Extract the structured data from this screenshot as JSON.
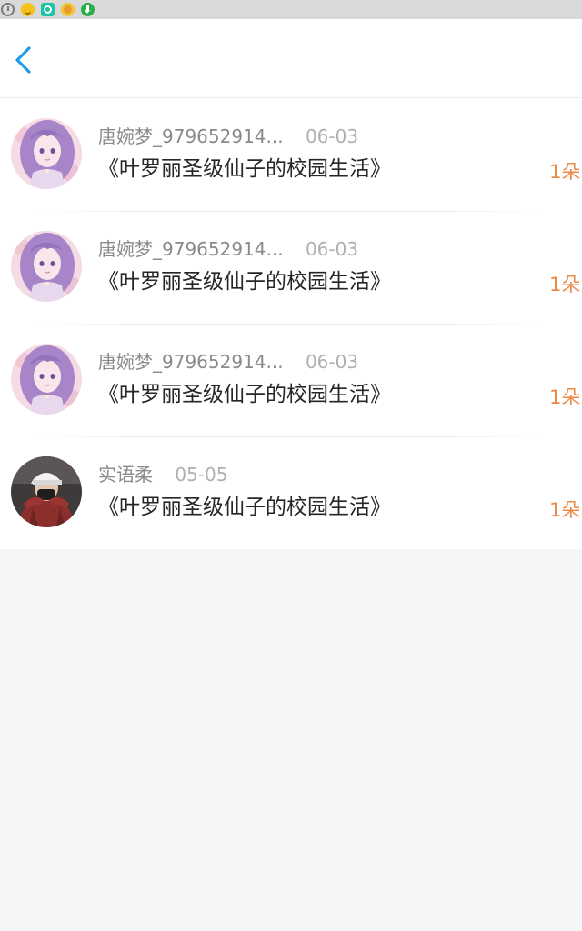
{
  "status_bar": {
    "icons": [
      "alarm-icon",
      "emoji-icon",
      "app-icon",
      "app-icon",
      "download-icon"
    ]
  },
  "nav": {
    "back_icon": "chevron-left-icon"
  },
  "colors": {
    "accent_blue": "#1e9be8",
    "amount_orange": "#ec8a47",
    "title_text": "#262626",
    "meta_text": "#8a8a8a"
  },
  "items": [
    {
      "user": "唐婉梦_979652914...",
      "date": "06-03",
      "title": "《叶罗丽圣级仙子的校园生活》",
      "amount": "1朵",
      "avatar": "anime-girl-avatar"
    },
    {
      "user": "唐婉梦_979652914...",
      "date": "06-03",
      "title": "《叶罗丽圣级仙子的校园生活》",
      "amount": "1朵",
      "avatar": "anime-girl-avatar"
    },
    {
      "user": "唐婉梦_979652914...",
      "date": "06-03",
      "title": "《叶罗丽圣级仙子的校园生活》",
      "amount": "1朵",
      "avatar": "anime-girl-avatar"
    },
    {
      "user": "实语柔",
      "date": "05-05",
      "title": "《叶罗丽圣级仙子的校园生活》",
      "amount": "1朵",
      "avatar": "masked-person-avatar"
    }
  ]
}
